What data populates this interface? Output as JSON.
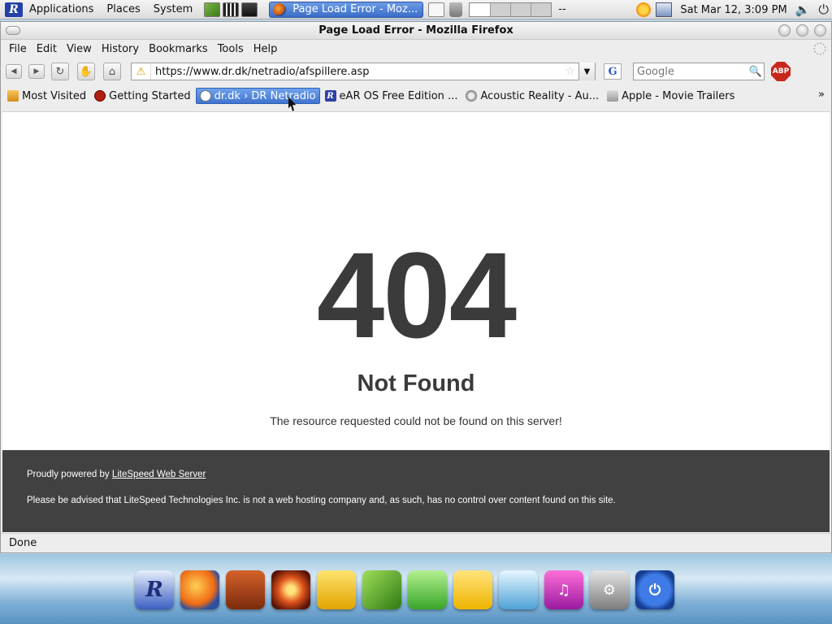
{
  "top_panel": {
    "menus": [
      "Applications",
      "Places",
      "System"
    ],
    "task_title": "Page Load Error - Moz...",
    "workspace_dash": "--",
    "clock": "Sat Mar 12,  3:09 PM"
  },
  "window": {
    "title": "Page Load Error - Mozilla Firefox"
  },
  "menubar": [
    "File",
    "Edit",
    "View",
    "History",
    "Bookmarks",
    "Tools",
    "Help"
  ],
  "navbar": {
    "url": "https://www.dr.dk/netradio/afspillere.asp",
    "search_placeholder": "Google",
    "engine_letter": "G",
    "abp_label": "ABP"
  },
  "bookmarks": [
    {
      "label": "Most Visited",
      "icon": "folder-icon"
    },
    {
      "label": "Getting Started",
      "icon": "getting-started-icon"
    },
    {
      "label": "dr.dk › DR Netradio",
      "icon": "dr-icon"
    },
    {
      "label": "eAR OS Free Edition ...",
      "icon": "ear-icon"
    },
    {
      "label": "Acoustic Reality - Au...",
      "icon": "acoustic-reality-icon"
    },
    {
      "label": "Apple - Movie Trailers",
      "icon": "apple-icon"
    }
  ],
  "bookmarks_more": "»",
  "page": {
    "code": "404",
    "title": "Not Found",
    "message": "The resource requested could not be found on this server!",
    "footer_prefix": "Proudly powered by ",
    "footer_link": "LiteSpeed Web Server",
    "footer_notice": "Please be advised that LiteSpeed Technologies Inc. is not a web hosting company and, as such, has no control over content found on this site."
  },
  "status": "Done",
  "colors": {
    "footer_bg": "#414141",
    "error_text": "#3b3b3b",
    "active_bookmark": "#3f74d0"
  }
}
